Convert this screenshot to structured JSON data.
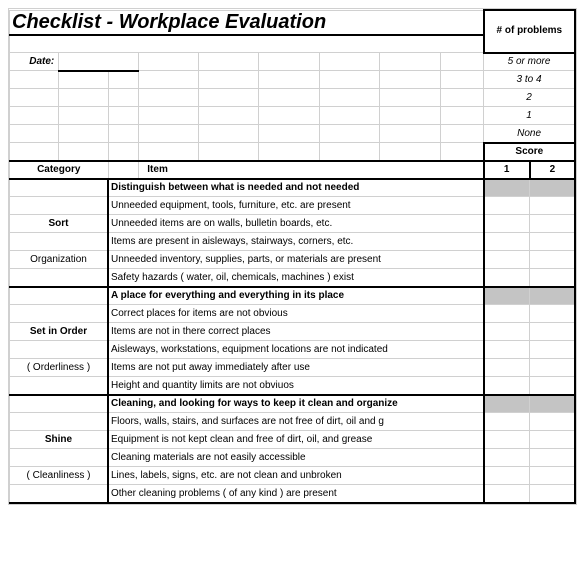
{
  "title": "Checklist - Workplace Evaluation",
  "date_label": "Date:",
  "problems_header": "# of problems",
  "problems_levels": [
    "5 or more",
    "3 to 4",
    "2",
    "1",
    "None"
  ],
  "score_label": "Score",
  "columns": {
    "category": "Category",
    "item": "Item",
    "s1": "1",
    "s2": "2"
  },
  "sections": [
    {
      "cat_main": "Sort",
      "cat_sub": "Organization",
      "heading": "Distinguish between what is needed and not needed",
      "items": [
        "Unneeded equipment, tools, furniture, etc. are present",
        "Unneeded items are on walls, bulletin boards, etc.",
        "Items are present in aisleways, stairways, corners, etc.",
        "Unneeded inventory, supplies, parts, or materials are present",
        "Safety hazards ( water, oil, chemicals, machines ) exist"
      ]
    },
    {
      "cat_main": "Set in Order",
      "cat_sub": "( Orderliness )",
      "heading": "A place for everything and everything in its place",
      "items": [
        "Correct places for items are not obvious",
        "Items are not in there correct places",
        "Aisleways, workstations, equipment locations are not indicated",
        "Items are not put away immediately after use",
        "Height and quantity limits are not obviuos"
      ]
    },
    {
      "cat_main": "Shine",
      "cat_sub": "( Cleanliness )",
      "heading": "Cleaning, and looking for ways to keep it clean and organize",
      "items": [
        "Floors, walls, stairs, and surfaces are not free of dirt, oil and g",
        "Equipment is not kept clean and free of dirt, oil, and grease",
        "Cleaning materials are not easily accessible",
        "Lines, labels, signs, etc. are not clean and unbroken",
        "Other cleaning problems ( of any kind ) are present"
      ]
    }
  ]
}
